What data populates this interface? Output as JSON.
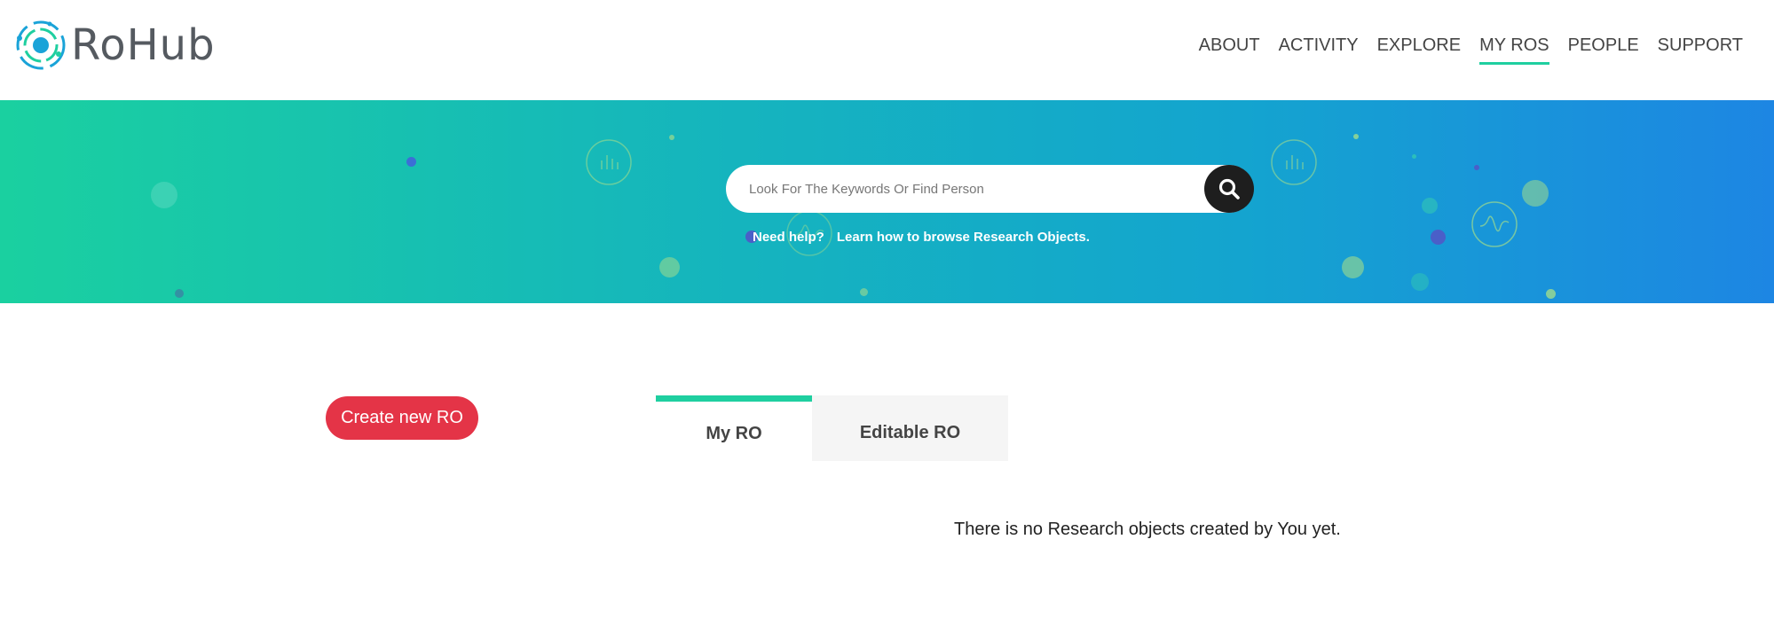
{
  "header": {
    "logo_text": "RoHub",
    "nav": [
      {
        "label": "ABOUT",
        "active": false
      },
      {
        "label": "ACTIVITY",
        "active": false
      },
      {
        "label": "EXPLORE",
        "active": false
      },
      {
        "label": "MY ROS",
        "active": true
      },
      {
        "label": "PEOPLE",
        "active": false
      },
      {
        "label": "SUPPORT",
        "active": false
      }
    ]
  },
  "banner": {
    "search_placeholder": "Look For The Keywords Or Find Person",
    "help_label": "Need help?",
    "help_link": "Learn how to browse Research Objects."
  },
  "main": {
    "create_button": "Create new RO",
    "tabs": [
      {
        "label": "My RO",
        "active": true
      },
      {
        "label": "Editable RO",
        "active": false
      }
    ],
    "empty_message": "There is no Research objects created by You yet."
  },
  "colors": {
    "accent": "#1fcfa0",
    "create_button": "#e43447",
    "search_button": "#1e1e1e"
  }
}
